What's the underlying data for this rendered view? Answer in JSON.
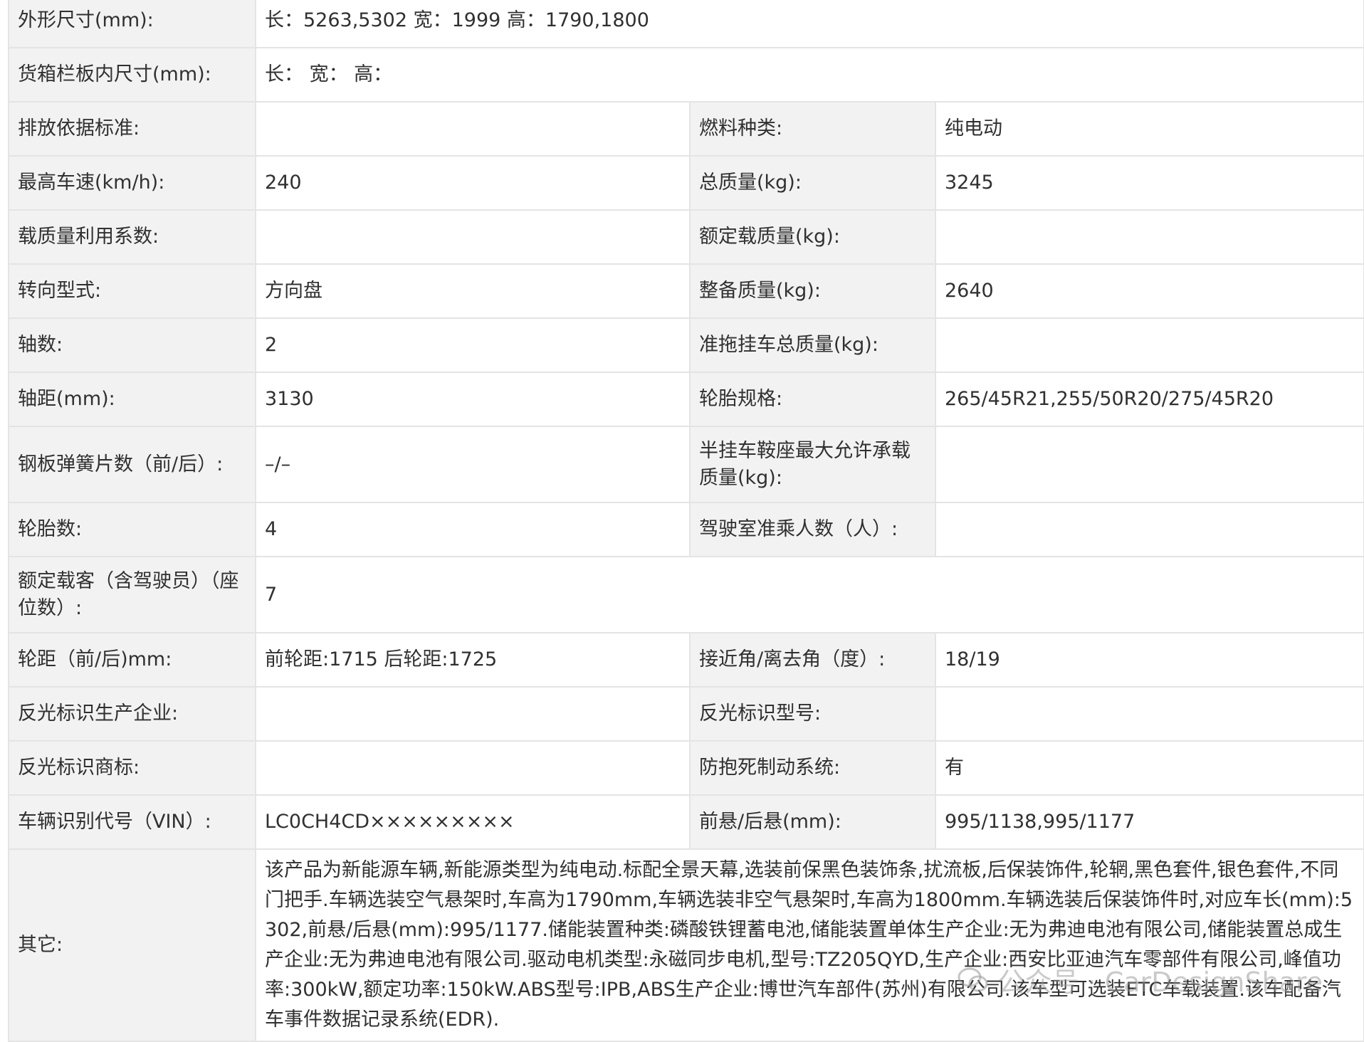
{
  "rows": [
    {
      "l1": "外形尺寸(mm):",
      "v1": "长：5263,5302 宽：1999 高：1790,1800"
    },
    {
      "l1": "货箱栏板内尺寸(mm):",
      "v1": "长：  宽：  高："
    },
    {
      "l1": "排放依据标准:",
      "v1": "",
      "l2": "燃料种类:",
      "v2": "纯电动"
    },
    {
      "l1": "最高车速(km/h):",
      "v1": "240",
      "l2": "总质量(kg):",
      "v2": "3245"
    },
    {
      "l1": "载质量利用系数:",
      "v1": "",
      "l2": "额定载质量(kg):",
      "v2": ""
    },
    {
      "l1": "转向型式:",
      "v1": "方向盘",
      "l2": "整备质量(kg):",
      "v2": "2640"
    },
    {
      "l1": "轴数:",
      "v1": "2",
      "l2": "准拖挂车总质量(kg):",
      "v2": ""
    },
    {
      "l1": "轴距(mm):",
      "v1": "3130",
      "l2": "轮胎规格:",
      "v2": "265/45R21,255/50R20/275/45R20"
    },
    {
      "l1": "钢板弹簧片数（前/后）:",
      "v1": "–/–",
      "l2": "半挂车鞍座最大允许承载质量(kg):",
      "v2": ""
    },
    {
      "l1": "轮胎数:",
      "v1": "4",
      "l2": "驾驶室准乘人数（人）:",
      "v2": ""
    },
    {
      "l1": "额定载客（含驾驶员）（座位数）:",
      "v1": "7"
    },
    {
      "l1": "轮距（前/后)mm:",
      "v1": "前轮距:1715 后轮距:1725",
      "l2": "接近角/离去角（度）:",
      "v2": "18/19"
    },
    {
      "l1": "反光标识生产企业:",
      "v1": "",
      "l2": "反光标识型号:",
      "v2": ""
    },
    {
      "l1": "反光标识商标:",
      "v1": "",
      "l2": "防抱死制动系统:",
      "v2": "有"
    },
    {
      "l1": "车辆识别代号（VIN）:",
      "v1": "LC0CH4CD×××××××××",
      "l2": "前悬/后悬(mm):",
      "v2": "995/1138,995/1177"
    },
    {
      "l1": "其它:",
      "v1": "该产品为新能源车辆,新能源类型为纯电动.标配全景天幕,选装前保黑色装饰条,扰流板,后保装饰件,轮辋,黑色套件,银色套件,不同门把手.车辆选装空气悬架时,车高为1790mm,车辆选装非空气悬架时,车高为1800mm.车辆选装后保装饰件时,对应车长(mm):5302,前悬/后悬(mm):995/1177.储能装置种类:磷酸铁锂蓄电池,储能装置单体生产企业:无为弗迪电池有限公司,储能装置总成生产企业:无为弗迪电池有限公司.驱动电机类型:永磁同步电机,型号:TZ205QYD,生产企业:西安比亚迪汽车零部件有限公司,峰值功率:300kW,额定功率:150kW.ABS型号:IPB,ABS生产企业:博世汽车部件(苏州)有限公司.该车型可选装ETC车载装置.该车配备汽车事件数据记录系统(EDR)."
    }
  ],
  "watermark": {
    "text": "公众号 · CarDesignShare",
    "icon": "wechat-icon"
  }
}
